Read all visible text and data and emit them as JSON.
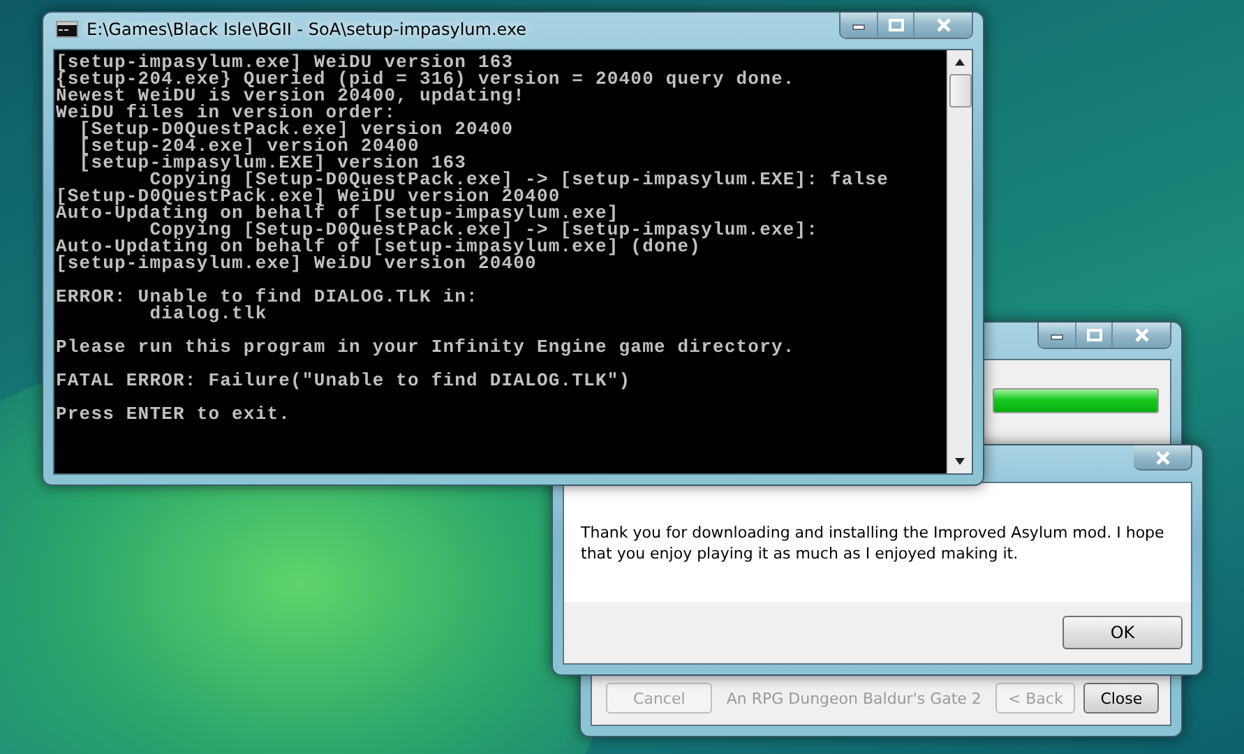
{
  "console_window": {
    "title": "E:\\Games\\Black Isle\\BGII - SoA\\setup-impasylum.exe",
    "blocks": [
      [
        "[setup-impasylum.exe] WeiDU version 163",
        "{setup-204.exe} Queried (pid = 316) version = 20400 query done.",
        "Newest WeiDU is version 20400, updating!",
        "WeiDU files in version order:",
        "  [Setup-D0QuestPack.exe] version 20400",
        "  [setup-204.exe] version 20400",
        "  [setup-impasylum.EXE] version 163",
        "        Copying [Setup-D0QuestPack.exe] -> [setup-impasylum.EXE]: false",
        "[Setup-D0QuestPack.exe] WeiDU version 20400",
        "Auto-Updating on behalf of [setup-impasylum.exe]",
        "        Copying [Setup-D0QuestPack.exe] -> [setup-impasylum.exe]:",
        "Auto-Updating on behalf of [setup-impasylum.exe] (done)",
        "[setup-impasylum.exe] WeiDU version 20400"
      ],
      [
        "ERROR: Unable to find DIALOG.TLK in:",
        "        dialog.tlk"
      ],
      [
        "Please run this program in your Infinity Engine game directory."
      ],
      [
        "FATAL ERROR: Failure(\"Unable to find DIALOG.TLK\")"
      ],
      [
        "Press ENTER to exit."
      ]
    ]
  },
  "installer_window": {
    "progress": {
      "level": 1
    },
    "buttons": [
      {
        "label": "Cancel",
        "disabled": true
      },
      {
        "label": "< Back",
        "disabled": true
      },
      {
        "label": "Close",
        "disabled": false
      }
    ],
    "branding": "An RPG Dungeon Baldur's Gate 2"
  },
  "message_dialog": {
    "message": "Thank you for downloading and installing the Improved Asylum mod.  I hope that you enjoy playing it as much as I enjoyed making it.",
    "buttons": [
      "OK"
    ]
  }
}
